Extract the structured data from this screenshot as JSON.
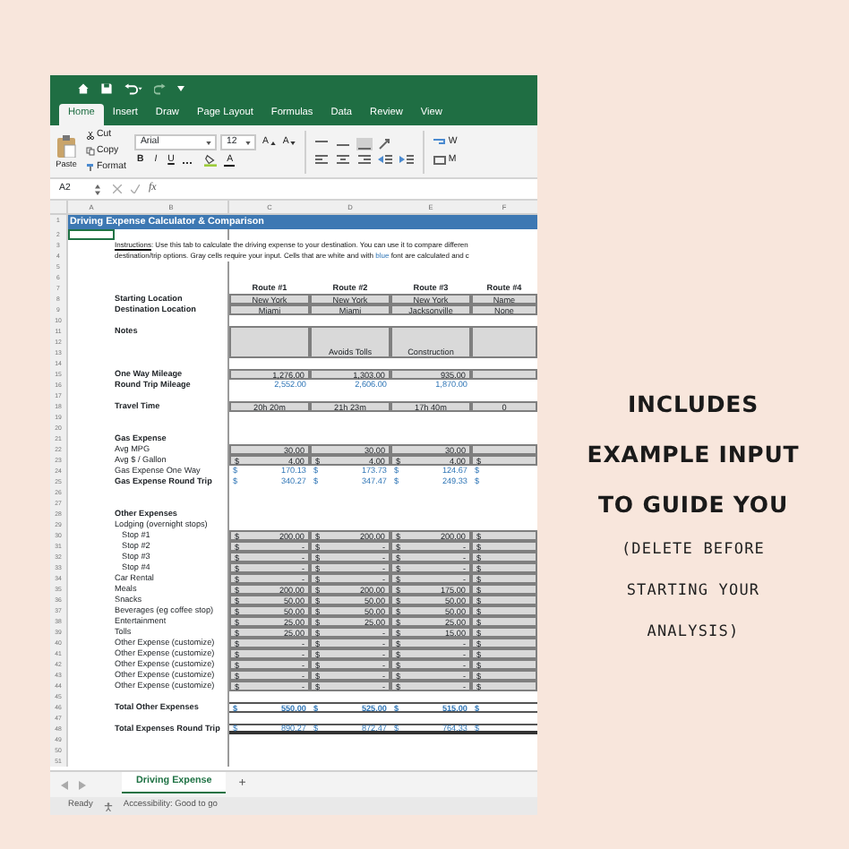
{
  "ribbon": {
    "tabs": [
      {
        "label": "Home",
        "selected": true
      },
      {
        "label": "Insert",
        "selected": false
      },
      {
        "label": "Draw",
        "selected": false
      },
      {
        "label": "Page Layout",
        "selected": false
      },
      {
        "label": "Formulas",
        "selected": false
      },
      {
        "label": "Data",
        "selected": false
      },
      {
        "label": "Review",
        "selected": false
      },
      {
        "label": "View",
        "selected": false
      }
    ],
    "clipboard": {
      "paste": "Paste",
      "cut": "Cut",
      "copy": "Copy",
      "format": "Format"
    },
    "font": {
      "name": "Arial",
      "size": "12",
      "grow": "A",
      "shrink": "A",
      "bold": "B",
      "italic": "I",
      "underline": "U",
      "font_color": "A"
    },
    "alignment": {
      "wrap": "W",
      "merge": "M"
    }
  },
  "formula_bar": {
    "name_box": "A2",
    "function_label": "fx"
  },
  "columns": [
    "A",
    "B",
    "C",
    "D",
    "E",
    "F"
  ],
  "sheet": {
    "rows": [
      {
        "number": "1",
        "kind": "title",
        "text": "Driving Expense Calculator & Comparison",
        "selected": false
      },
      {
        "number": "2",
        "kind": "blank",
        "selected": true
      },
      {
        "number": "3",
        "kind": "instructions",
        "parts": [
          {
            "text": "Instructions",
            "kind": "heading"
          },
          {
            "text": ": Use this tab to calculate the driving expense to your destination.  You can use it to compare differen",
            "kind": "plain"
          }
        ],
        "selected": false
      },
      {
        "number": "4",
        "kind": "instructions",
        "parts": [
          {
            "text": "destination/trip options.  Gray cells require your input.  Cells that are white and with ",
            "kind": "plain"
          },
          {
            "text": "blue",
            "kind": "calculated"
          },
          {
            "text": " font are calculated and c",
            "kind": "plain"
          }
        ],
        "selected": false
      },
      {
        "number": "5",
        "kind": "blank",
        "selected": false
      },
      {
        "number": "6",
        "kind": "blank",
        "selected": false
      },
      {
        "number": "7",
        "kind": "routes",
        "cells": [
          "Route #1",
          "Route #2",
          "Route #3",
          "Route #4"
        ],
        "selected": false
      },
      {
        "number": "8",
        "kind": "text_input",
        "label": "Starting Location",
        "bold": true,
        "cells": [
          "New York",
          "New York",
          "New York",
          "Name"
        ],
        "selected": false
      },
      {
        "number": "9",
        "kind": "text_input",
        "label": "Destination Location",
        "bold": true,
        "cells": [
          "Miami",
          "Miami",
          "Jacksonville",
          "None"
        ],
        "selected": false
      },
      {
        "number": "10",
        "kind": "blank",
        "selected": false
      },
      {
        "number": "11",
        "kind": "notes",
        "label": "Notes",
        "bold": true,
        "selected": false
      },
      {
        "number": "12",
        "kind": "notes",
        "selected": false
      },
      {
        "number": "13",
        "kind": "notes",
        "cells": [
          null,
          "Avoids Tolls",
          "Construction",
          null
        ],
        "selected": false
      },
      {
        "number": "14",
        "kind": "blank",
        "selected": false
      },
      {
        "number": "15",
        "kind": "number_input",
        "label": "One Way Mileage",
        "bold": true,
        "cells": [
          "1,276.00",
          "1,303.00",
          "935.00",
          null
        ],
        "selected": false
      },
      {
        "number": "16",
        "kind": "calc",
        "label": "Round Trip Mileage",
        "bold": true,
        "cells": [
          "2,552.00",
          "2,606.00",
          "1,870.00",
          null
        ],
        "selected": false
      },
      {
        "number": "17",
        "kind": "blank",
        "selected": false
      },
      {
        "number": "18",
        "kind": "text_input",
        "label": "Travel Time",
        "bold": true,
        "cells": [
          "20h 20m",
          "21h 23m",
          "17h 40m",
          "0"
        ],
        "selected": false
      },
      {
        "number": "19",
        "kind": "blank",
        "selected": false
      },
      {
        "number": "20",
        "kind": "blank",
        "selected": false
      },
      {
        "number": "21",
        "kind": "label",
        "label": "Gas Expense",
        "bold": true,
        "selected": false
      },
      {
        "number": "22",
        "kind": "number_input",
        "label": "Avg MPG",
        "bold": false,
        "cells": [
          "30.00",
          "30.00",
          "30.00",
          null
        ],
        "selected": false
      },
      {
        "number": "23",
        "kind": "number_input",
        "label": "Avg $ / Gallon",
        "bold": false,
        "cells": [
          {
            "unit": "$",
            "value": "4.00"
          },
          {
            "unit": "$",
            "value": "4.00"
          },
          {
            "unit": "$",
            "value": "4.00"
          },
          {
            "unit": "$"
          }
        ],
        "selected": false
      },
      {
        "number": "24",
        "kind": "calc",
        "label": "Gas Expense One Way",
        "bold": false,
        "cells": [
          {
            "unit": "$",
            "value": "170.13"
          },
          {
            "unit": "$",
            "value": "173.73"
          },
          {
            "unit": "$",
            "value": "124.67"
          },
          {
            "unit": "$"
          }
        ],
        "selected": false
      },
      {
        "number": "25",
        "kind": "calc",
        "label": "Gas Expense Round Trip",
        "bold": true,
        "cells": [
          {
            "unit": "$",
            "value": "340.27"
          },
          {
            "unit": "$",
            "value": "347.47"
          },
          {
            "unit": "$",
            "value": "249.33"
          },
          {
            "unit": "$"
          }
        ],
        "selected": false
      },
      {
        "number": "26",
        "kind": "blank",
        "selected": false
      },
      {
        "number": "27",
        "kind": "blank",
        "selected": false
      },
      {
        "number": "28",
        "kind": "label",
        "label": "Other Expenses",
        "bold": true,
        "selected": false
      },
      {
        "number": "29",
        "kind": "label",
        "label": "Lodging (overnight stops)",
        "bold": false,
        "selected": false
      },
      {
        "number": "30",
        "kind": "number_input",
        "label": "Stop #1",
        "indent": true,
        "bold": false,
        "cells": [
          {
            "unit": "$",
            "value": "200.00"
          },
          {
            "unit": "$",
            "value": "200.00"
          },
          {
            "unit": "$",
            "value": "200.00"
          },
          {
            "unit": "$"
          }
        ],
        "selected": false
      },
      {
        "number": "31",
        "kind": "number_input",
        "label": "Stop #2",
        "indent": true,
        "bold": false,
        "cells": [
          {
            "unit": "$",
            "value": "-"
          },
          {
            "unit": "$",
            "value": "-"
          },
          {
            "unit": "$",
            "value": "-"
          },
          {
            "unit": "$"
          }
        ],
        "selected": false
      },
      {
        "number": "32",
        "kind": "number_input",
        "label": "Stop #3",
        "indent": true,
        "bold": false,
        "cells": [
          {
            "unit": "$",
            "value": "-"
          },
          {
            "unit": "$",
            "value": "-"
          },
          {
            "unit": "$",
            "value": "-"
          },
          {
            "unit": "$"
          }
        ],
        "selected": false
      },
      {
        "number": "33",
        "kind": "number_input",
        "label": "Stop #4",
        "indent": true,
        "bold": false,
        "cells": [
          {
            "unit": "$",
            "value": "-"
          },
          {
            "unit": "$",
            "value": "-"
          },
          {
            "unit": "$",
            "value": "-"
          },
          {
            "unit": "$"
          }
        ],
        "selected": false
      },
      {
        "number": "34",
        "kind": "number_input",
        "label": "Car Rental",
        "bold": false,
        "cells": [
          {
            "unit": "$",
            "value": "-"
          },
          {
            "unit": "$",
            "value": "-"
          },
          {
            "unit": "$",
            "value": "-"
          },
          {
            "unit": "$"
          }
        ],
        "selected": false
      },
      {
        "number": "35",
        "kind": "number_input",
        "label": "Meals",
        "bold": false,
        "cells": [
          {
            "unit": "$",
            "value": "200.00"
          },
          {
            "unit": "$",
            "value": "200.00"
          },
          {
            "unit": "$",
            "value": "175.00"
          },
          {
            "unit": "$"
          }
        ],
        "selected": false
      },
      {
        "number": "36",
        "kind": "number_input",
        "label": "Snacks",
        "bold": false,
        "cells": [
          {
            "unit": "$",
            "value": "50.00"
          },
          {
            "unit": "$",
            "value": "50.00"
          },
          {
            "unit": "$",
            "value": "50.00"
          },
          {
            "unit": "$"
          }
        ],
        "selected": false
      },
      {
        "number": "37",
        "kind": "number_input",
        "label": "Beverages (eg coffee stop)",
        "bold": false,
        "cells": [
          {
            "unit": "$",
            "value": "50.00"
          },
          {
            "unit": "$",
            "value": "50.00"
          },
          {
            "unit": "$",
            "value": "50.00"
          },
          {
            "unit": "$"
          }
        ],
        "selected": false
      },
      {
        "number": "38",
        "kind": "number_input",
        "label": "Entertainment",
        "bold": false,
        "cells": [
          {
            "unit": "$",
            "value": "25.00"
          },
          {
            "unit": "$",
            "value": "25.00"
          },
          {
            "unit": "$",
            "value": "25.00"
          },
          {
            "unit": "$"
          }
        ],
        "selected": false
      },
      {
        "number": "39",
        "kind": "number_input",
        "label": "Tolls",
        "bold": false,
        "cells": [
          {
            "unit": "$",
            "value": "25.00"
          },
          {
            "unit": "$",
            "value": "-"
          },
          {
            "unit": "$",
            "value": "15.00"
          },
          {
            "unit": "$"
          }
        ],
        "selected": false
      },
      {
        "number": "40",
        "kind": "number_input",
        "label": "Other Expense (customize)",
        "bold": false,
        "cells": [
          {
            "unit": "$",
            "value": "-"
          },
          {
            "unit": "$",
            "value": "-"
          },
          {
            "unit": "$",
            "value": "-"
          },
          {
            "unit": "$"
          }
        ],
        "selected": false
      },
      {
        "number": "41",
        "kind": "number_input",
        "label": "Other Expense (customize)",
        "bold": false,
        "cells": [
          {
            "unit": "$",
            "value": "-"
          },
          {
            "unit": "$",
            "value": "-"
          },
          {
            "unit": "$",
            "value": "-"
          },
          {
            "unit": "$"
          }
        ],
        "selected": false
      },
      {
        "number": "42",
        "kind": "number_input",
        "label": "Other Expense (customize)",
        "bold": false,
        "cells": [
          {
            "unit": "$",
            "value": "-"
          },
          {
            "unit": "$",
            "value": "-"
          },
          {
            "unit": "$",
            "value": "-"
          },
          {
            "unit": "$"
          }
        ],
        "selected": false
      },
      {
        "number": "43",
        "kind": "number_input",
        "label": "Other Expense (customize)",
        "bold": false,
        "cells": [
          {
            "unit": "$",
            "value": "-"
          },
          {
            "unit": "$",
            "value": "-"
          },
          {
            "unit": "$",
            "value": "-"
          },
          {
            "unit": "$"
          }
        ],
        "selected": false
      },
      {
        "number": "44",
        "kind": "number_input",
        "label": "Other Expense (customize)",
        "bold": false,
        "cells": [
          {
            "unit": "$",
            "value": "-"
          },
          {
            "unit": "$",
            "value": "-"
          },
          {
            "unit": "$",
            "value": "-"
          },
          {
            "unit": "$"
          }
        ],
        "selected": false
      },
      {
        "number": "45",
        "kind": "blank",
        "selected": false
      },
      {
        "number": "46",
        "kind": "total",
        "label": "Total Other Expenses",
        "bold": true,
        "cells": [
          {
            "unit": "$",
            "value": "550.00"
          },
          {
            "unit": "$",
            "value": "525.00"
          },
          {
            "unit": "$",
            "value": "515.00"
          },
          {
            "unit": "$"
          }
        ],
        "selected": false
      },
      {
        "number": "47",
        "kind": "blank",
        "selected": false
      },
      {
        "number": "48",
        "kind": "grand_total",
        "label": "Total Expenses Round Trip",
        "bold": true,
        "cells": [
          {
            "unit": "$",
            "value": "890.27"
          },
          {
            "unit": "$",
            "value": "872.47"
          },
          {
            "unit": "$",
            "value": "764.33"
          },
          {
            "unit": "$"
          }
        ],
        "selected": false
      },
      {
        "number": "49",
        "kind": "blank",
        "selected": false
      },
      {
        "number": "50",
        "kind": "blank",
        "selected": false
      },
      {
        "number": "51",
        "kind": "blank",
        "selected": false
      }
    ]
  },
  "sheet_tabs": {
    "tabs": [
      {
        "label": "Driving Expense",
        "selected": true
      }
    ],
    "add": "+"
  },
  "status_bar": {
    "status": "Ready",
    "accessibility": "Accessibility: Good to go"
  },
  "promo": {
    "headline": [
      "INCLUDES",
      "EXAMPLE INPUT",
      "TO GUIDE YOU"
    ],
    "note": [
      "(DELETE BEFORE",
      "STARTING YOUR",
      "ANALYSIS)"
    ]
  }
}
